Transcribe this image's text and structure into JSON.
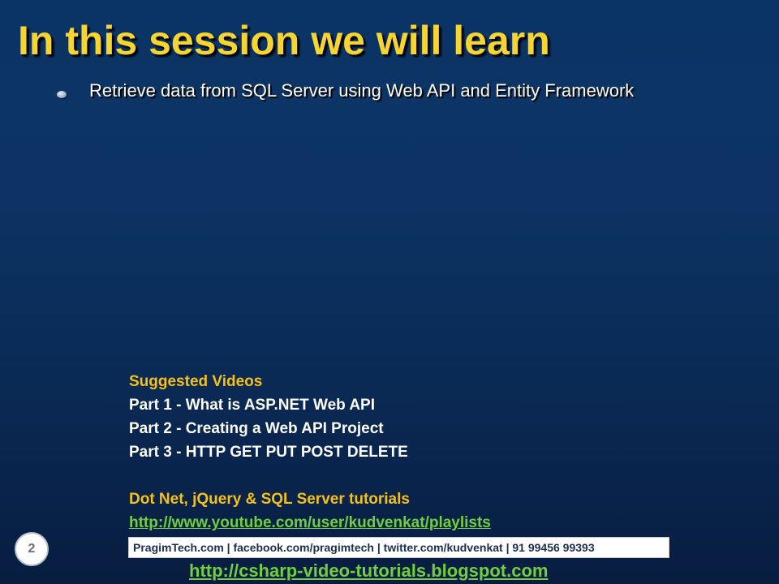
{
  "slide": {
    "title": "In this session we will learn",
    "bullets": [
      "Retrieve data from SQL Server using Web API and Entity Framework"
    ],
    "suggested": {
      "heading": "Suggested Videos",
      "videos": [
        "Part 1 - What is ASP.NET Web API",
        "Part 2 - Creating a Web API Project",
        "Part 3 - HTTP GET PUT POST DELETE"
      ],
      "tutorials_heading": "Dot Net, jQuery & SQL Server tutorials",
      "youtube_link": "http://www.youtube.com/user/kudvenkat/playlists"
    },
    "info_bar": "PragimTech.com | facebook.com/pragimtech | twitter.com/kudvenkat | 91 99456 99393",
    "page_number": "2",
    "blog_link": "http://csharp-video-tutorials.blogspot.com"
  },
  "colors": {
    "title": "#f7d531",
    "heading": "#f5c117",
    "link": "#6fcf3f",
    "background_top": "#0b3466",
    "background_bottom": "#081d40"
  }
}
